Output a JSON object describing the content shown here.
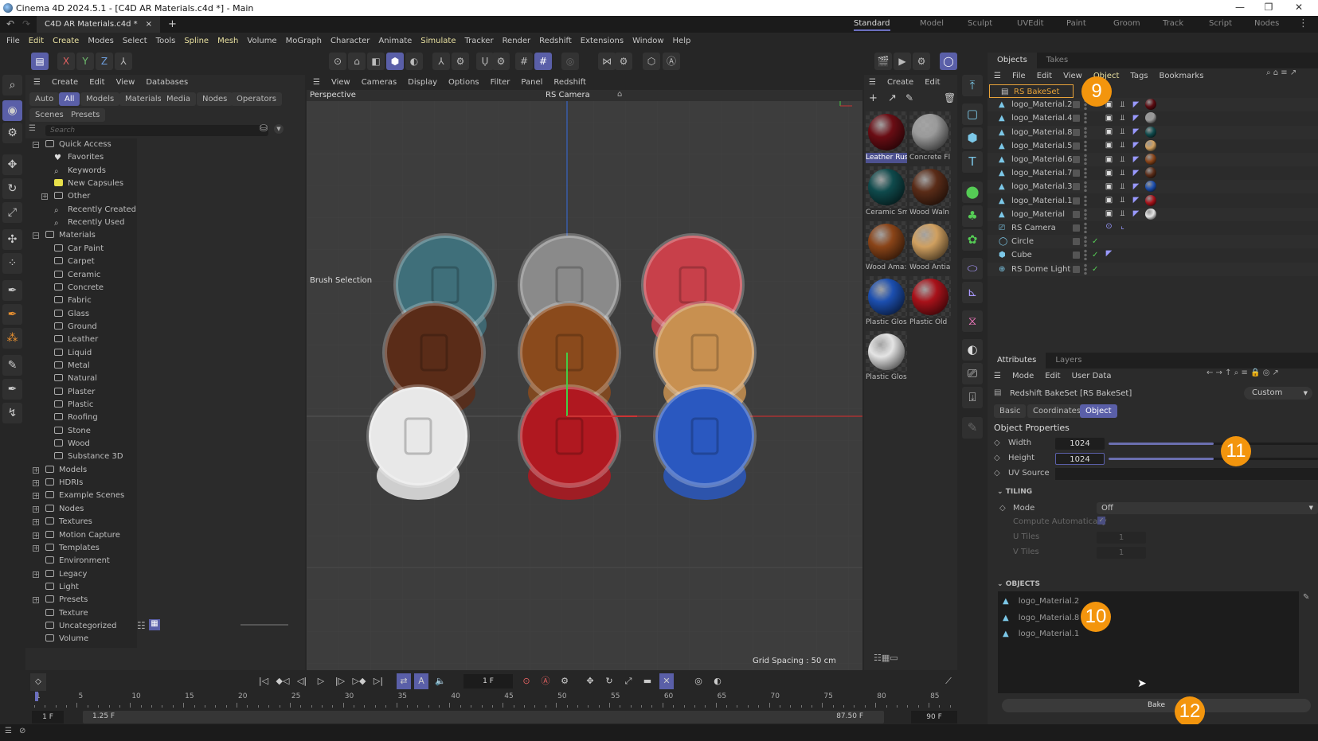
{
  "window": {
    "title": "Cinema 4D 2024.5.1 - [C4D AR Materials.c4d *] - Main",
    "minimize": "—",
    "maximize": "❐",
    "close": "✕"
  },
  "doc_tab": {
    "label": "C4D AR Materials.c4d *",
    "close": "×",
    "add": "+"
  },
  "layouts": [
    "Standard",
    "Model",
    "Sculpt",
    "UVEdit",
    "Paint",
    "Groom",
    "Track",
    "Script",
    "Nodes"
  ],
  "active_layout": "Standard",
  "menu": [
    "File",
    "Edit",
    "Create",
    "Modes",
    "Select",
    "Tools",
    "Spline",
    "Mesh",
    "Volume",
    "MoGraph",
    "Character",
    "Animate",
    "Simulate",
    "Tracker",
    "Render",
    "Redshift",
    "Extensions",
    "Window",
    "Help"
  ],
  "axis_buttons": [
    "X",
    "Y",
    "Z"
  ],
  "asset_browser": {
    "menu": [
      "Create",
      "Edit",
      "View",
      "Databases"
    ],
    "filters": [
      "Auto",
      "All",
      "Models",
      "Materials",
      "Media",
      "Nodes",
      "Operators",
      "Scenes",
      "Presets"
    ],
    "active_filter": "All",
    "search_placeholder": "Search",
    "tree": [
      {
        "label": "Quick Access",
        "level": 0,
        "expanded": true
      },
      {
        "label": "Favorites",
        "level": 1,
        "icon": "heart-icon"
      },
      {
        "label": "Keywords",
        "level": 1,
        "icon": "search-icon"
      },
      {
        "label": "New Capsules",
        "level": 1,
        "icon": "folder-icon"
      },
      {
        "label": "Other",
        "level": 1,
        "collapsed": true
      },
      {
        "label": "Recently Created",
        "level": 1,
        "icon": "search-icon"
      },
      {
        "label": "Recently Used",
        "level": 1,
        "icon": "search-icon"
      },
      {
        "label": "Materials",
        "level": 0,
        "expanded": true
      },
      {
        "label": "Car Paint",
        "level": 1
      },
      {
        "label": "Carpet",
        "level": 1
      },
      {
        "label": "Ceramic",
        "level": 1
      },
      {
        "label": "Concrete",
        "level": 1
      },
      {
        "label": "Fabric",
        "level": 1
      },
      {
        "label": "Glass",
        "level": 1
      },
      {
        "label": "Ground",
        "level": 1
      },
      {
        "label": "Leather",
        "level": 1
      },
      {
        "label": "Liquid",
        "level": 1
      },
      {
        "label": "Metal",
        "level": 1
      },
      {
        "label": "Natural",
        "level": 1
      },
      {
        "label": "Plaster",
        "level": 1
      },
      {
        "label": "Plastic",
        "level": 1
      },
      {
        "label": "Roofing",
        "level": 1
      },
      {
        "label": "Stone",
        "level": 1
      },
      {
        "label": "Wood",
        "level": 1
      },
      {
        "label": "Substance 3D",
        "level": 1
      },
      {
        "label": "Models",
        "level": 0,
        "collapsed": true
      },
      {
        "label": "HDRIs",
        "level": 0,
        "collapsed": true
      },
      {
        "label": "Example Scenes",
        "level": 0,
        "collapsed": true
      },
      {
        "label": "Nodes",
        "level": 0,
        "collapsed": true
      },
      {
        "label": "Textures",
        "level": 0,
        "collapsed": true
      },
      {
        "label": "Motion Capture",
        "level": 0,
        "collapsed": true
      },
      {
        "label": "Templates",
        "level": 0,
        "collapsed": true
      },
      {
        "label": "Environment",
        "level": 0
      },
      {
        "label": "Legacy",
        "level": 0,
        "collapsed": true
      },
      {
        "label": "Light",
        "level": 0
      },
      {
        "label": "Presets",
        "level": 0,
        "collapsed": true
      },
      {
        "label": "Texture",
        "level": 0
      },
      {
        "label": "Uncategorized",
        "level": 0
      },
      {
        "label": "Volume",
        "level": 0
      }
    ]
  },
  "viewport": {
    "menu": [
      "View",
      "Cameras",
      "Display",
      "Options",
      "Filter",
      "Panel",
      "Redshift"
    ],
    "view_name": "Perspective",
    "camera": "RS Camera",
    "tool_label": "Brush Selection",
    "grid_spacing": "Grid Spacing : 50 cm"
  },
  "material_shelf": {
    "menu": [
      "Create",
      "Edit"
    ],
    "materials": [
      {
        "label": "Leather Rus",
        "color": "#6a0d14",
        "selected": true
      },
      {
        "label": "Concrete Fl",
        "color": "#9a9a9a"
      },
      {
        "label": "Ceramic Sm",
        "color": "#0f4a4c"
      },
      {
        "label": "Wood Waln",
        "color": "#5a2c18"
      },
      {
        "label": "Wood Ama:",
        "color": "#8a4418"
      },
      {
        "label": "Wood Antia",
        "color": "#d0a060"
      },
      {
        "label": "Plastic Glos",
        "color": "#1c4fb0"
      },
      {
        "label": "Plastic Old",
        "color": "#a8121a"
      },
      {
        "label": "Plastic Glos",
        "color": "#e4e4e4"
      }
    ]
  },
  "objects_panel": {
    "tabs": [
      "Objects",
      "Takes"
    ],
    "menu": [
      "File",
      "Edit",
      "View",
      "Object",
      "Tags",
      "Bookmarks"
    ],
    "rows": [
      {
        "name": "RS BakeSet",
        "icon": "bakeset-icon",
        "selected": true
      },
      {
        "name": "logo_Material.2",
        "icon": "polygon-icon",
        "material": "#5a0a10"
      },
      {
        "name": "logo_Material.4",
        "icon": "polygon-icon",
        "material": "#9a9a9a"
      },
      {
        "name": "logo_Material.8",
        "icon": "polygon-icon",
        "material": "#0f4a4c"
      },
      {
        "name": "logo_Material.5",
        "icon": "polygon-icon",
        "material": "#d0a060"
      },
      {
        "name": "logo_Material.6",
        "icon": "polygon-icon",
        "material": "#8a4418"
      },
      {
        "name": "logo_Material.7",
        "icon": "polygon-icon",
        "material": "#5a2c18"
      },
      {
        "name": "logo_Material.3",
        "icon": "polygon-icon",
        "material": "#1c4fb0"
      },
      {
        "name": "logo_Material.1",
        "icon": "polygon-icon",
        "material": "#a8121a"
      },
      {
        "name": "logo_Material",
        "icon": "polygon-icon",
        "material": "#e4e4e4"
      },
      {
        "name": "RS Camera",
        "icon": "camera-icon"
      },
      {
        "name": "Circle",
        "icon": "circle-icon",
        "check": true
      },
      {
        "name": "Cube",
        "icon": "cube-icon",
        "check": true
      },
      {
        "name": "RS Dome Light",
        "icon": "dome-light-icon",
        "check": true
      }
    ]
  },
  "attributes": {
    "tabs": [
      "Attributes",
      "Layers"
    ],
    "menu": [
      "Mode",
      "Edit",
      "User Data"
    ],
    "object_title": "Redshift BakeSet [RS BakeSet]",
    "preset": "Custom",
    "subtabs": [
      "Basic",
      "Coordinates",
      "Object"
    ],
    "active_subtab": "Object",
    "section": "Object Properties",
    "width_label": "Width",
    "width": "1024",
    "width_slider": 0.5,
    "height_label": "Height",
    "height": "1024",
    "height_slider": 0.5,
    "uv_label": "UV Source",
    "uv_value": "",
    "tiling_header": "TILING",
    "mode_label": "Mode",
    "mode_value": "Off",
    "compute_label": "Compute Automatically",
    "compute_checked": true,
    "u_label": "U Tiles",
    "u_value": "1",
    "v_label": "V Tiles",
    "v_value": "1",
    "objects_header": "OBJECTS",
    "objects": [
      "logo_Material.2",
      "logo_Material.8",
      "logo_Material.1"
    ],
    "bake_label": "Bake"
  },
  "annotations": [
    "9",
    "10",
    "11",
    "12"
  ],
  "timeline": {
    "current_frame": "1 F",
    "ticks": [
      "1",
      "5",
      "10",
      "15",
      "20",
      "25",
      "30",
      "35",
      "40",
      "45",
      "50",
      "55",
      "60",
      "65",
      "70",
      "75",
      "80",
      "85"
    ],
    "range_start": "1 F",
    "range_min": "1.25 F",
    "range_max": "87.50 F",
    "range_end": "90 F"
  },
  "colors": {
    "accent": "#5a5fa8",
    "annotation": "#f3950d",
    "selected_object": "#e8a33a"
  }
}
